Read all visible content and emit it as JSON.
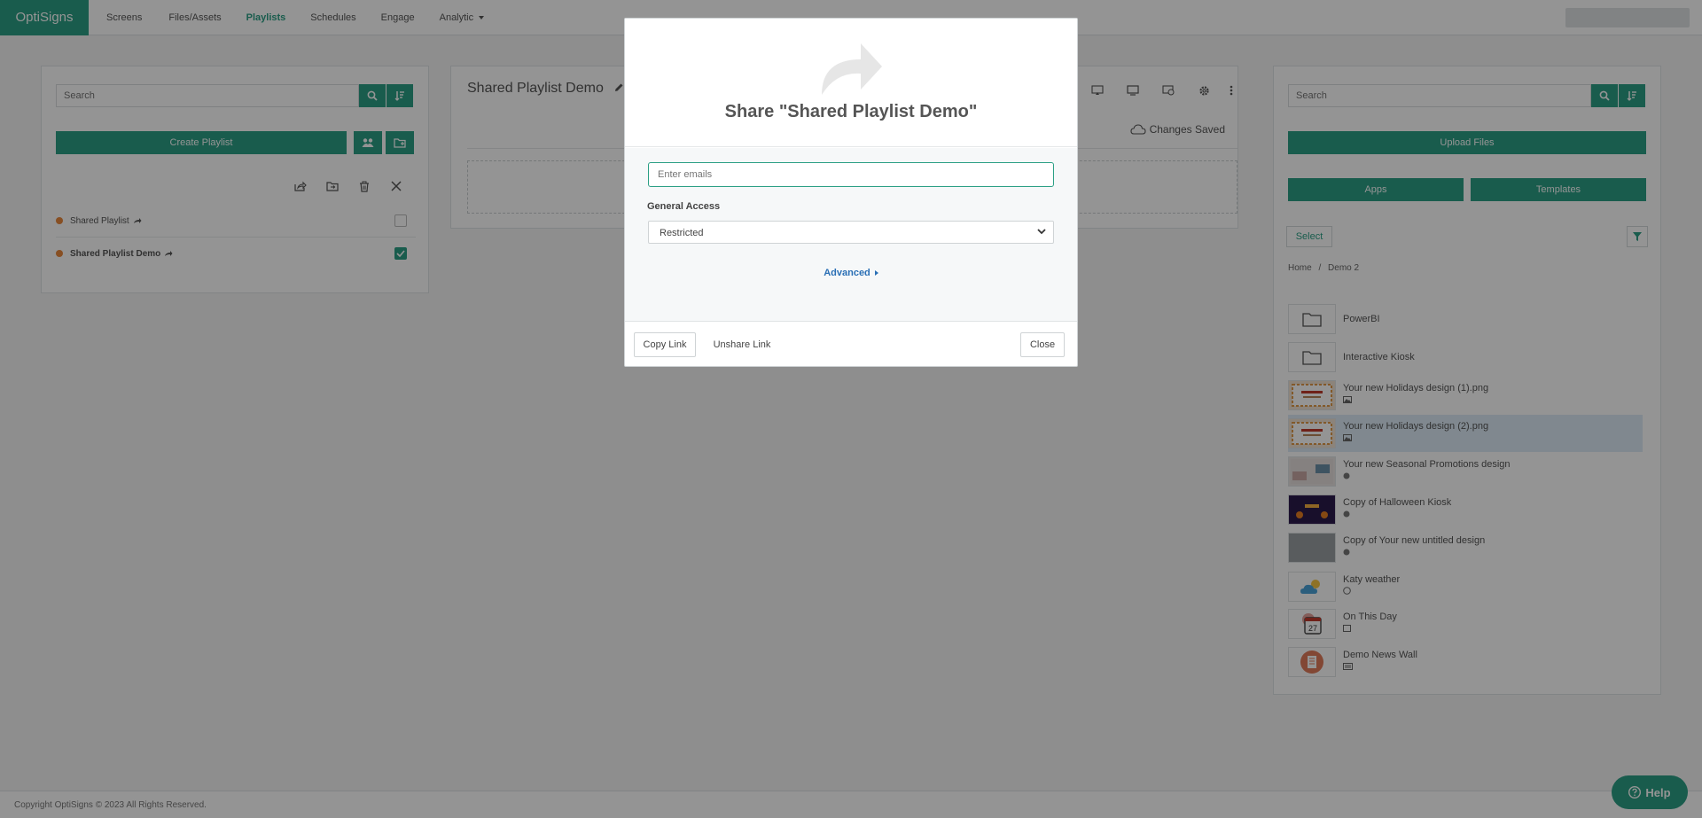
{
  "nav": {
    "brand": "OptiSigns",
    "items": [
      {
        "label": "Screens"
      },
      {
        "label": "Files/Assets"
      },
      {
        "label": "Playlists"
      },
      {
        "label": "Schedules"
      },
      {
        "label": "Engage"
      },
      {
        "label": "Analytic"
      }
    ],
    "active": "Playlists"
  },
  "left": {
    "search_placeholder": "Search",
    "create_label": "Create Playlist",
    "playlists": [
      {
        "name": "Shared Playlist",
        "checked": false
      },
      {
        "name": "Shared Playlist Demo",
        "checked": true
      }
    ]
  },
  "mid": {
    "title": "Shared Playlist Demo",
    "status": "Changes Saved"
  },
  "right": {
    "search_placeholder": "Search",
    "upload_label": "Upload Files",
    "apps_label": "Apps",
    "templates_label": "Templates",
    "select_label": "Select",
    "breadcrumb_home": "Home",
    "breadcrumb_sep": "/",
    "breadcrumb_current": "Demo 2",
    "assets": [
      {
        "name": "PowerBI",
        "icon": "folder-icon"
      },
      {
        "name": "Interactive Kiosk",
        "icon": "folder-icon"
      },
      {
        "name": "Your new Holidays design (1).png",
        "icon": "image-icon"
      },
      {
        "name": "Your new Holidays design (2).png",
        "icon": "image-icon",
        "selected": true
      },
      {
        "name": "Your new Seasonal Promotions design",
        "icon": "design-icon"
      },
      {
        "name": "Copy of Halloween Kiosk",
        "icon": "design-icon"
      },
      {
        "name": "Copy of Your new untitled design",
        "icon": "design-icon"
      },
      {
        "name": "Katy weather",
        "icon": "weather-icon"
      },
      {
        "name": "On This Day",
        "icon": "calendar-icon",
        "thumb_text": "27"
      },
      {
        "name": "Demo News Wall",
        "icon": "news-icon"
      }
    ]
  },
  "modal": {
    "title": "Share \"Shared Playlist Demo\"",
    "email_placeholder": "Enter emails",
    "general_access_label": "General Access",
    "general_access_value": "Restricted",
    "advanced_label": "Advanced",
    "copy_link": "Copy Link",
    "unshare_link": "Unshare Link",
    "close": "Close"
  },
  "footer": {
    "copyright": "Copyright OptiSigns © 2023 All Rights Reserved."
  },
  "help_label": "Help",
  "colors": {
    "accent": "#2b9f85",
    "link": "#2a6fb5",
    "dot": "#e9883d"
  }
}
